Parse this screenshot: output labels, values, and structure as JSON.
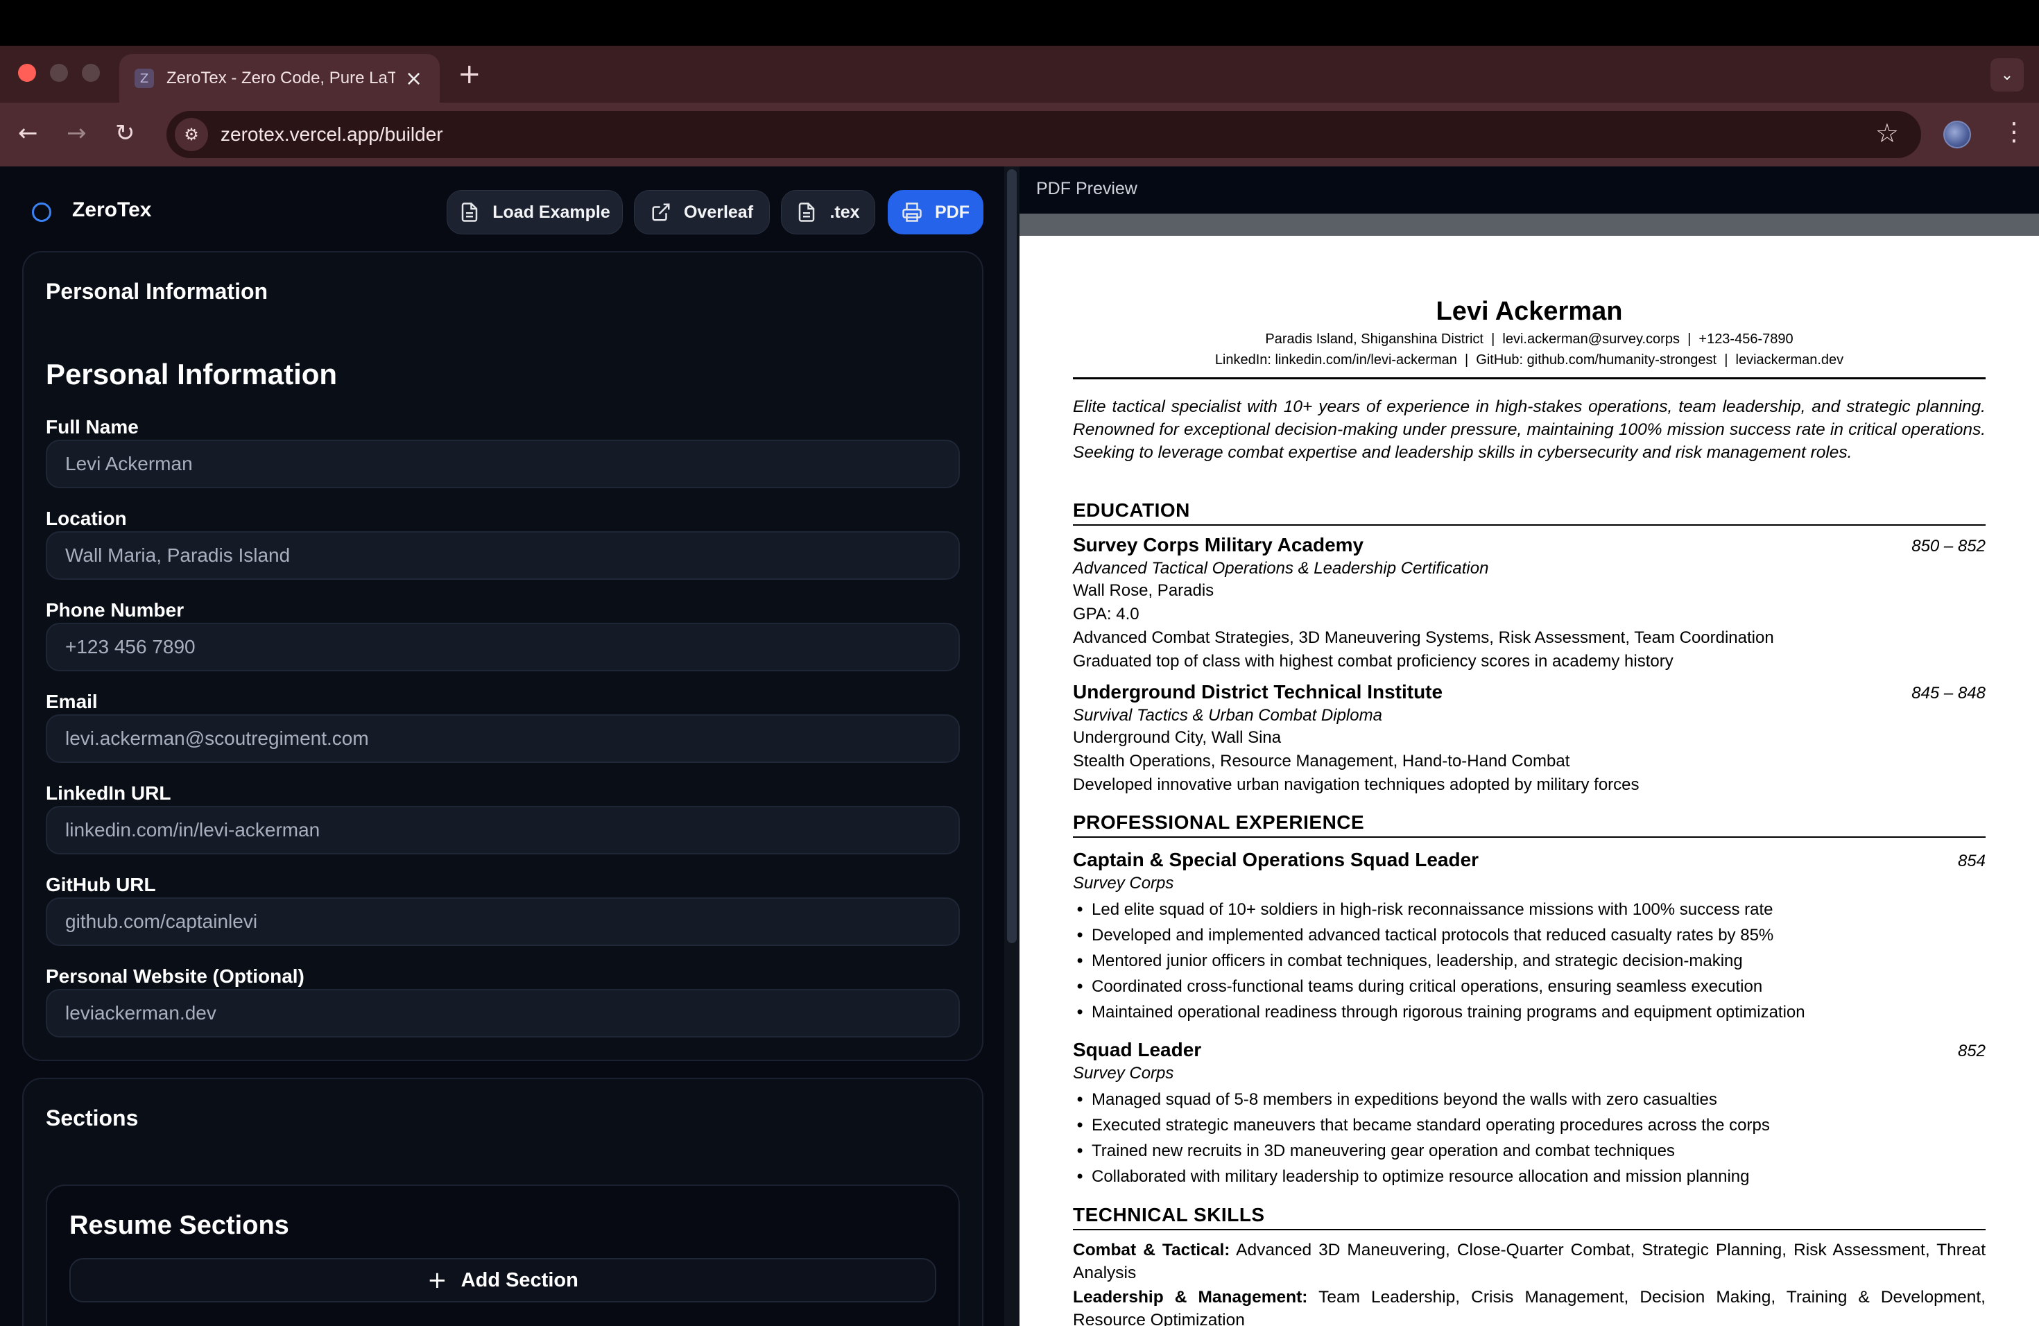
{
  "browser": {
    "tab_title": "ZeroTex - Zero Code, Pure LaTeX",
    "tab_favicon": "Z",
    "url": "zerotex.vercel.app/builder"
  },
  "app": {
    "logo": "ZeroTex",
    "toolbar": {
      "load_example": "Load Example",
      "overleaf": "Overleaf",
      "tex": ".tex",
      "pdf": "PDF"
    },
    "personal_card_title": "Personal Information",
    "personal_heading": "Personal Information",
    "fields": [
      {
        "label": "Full Name",
        "value": "Levi Ackerman"
      },
      {
        "label": "Location",
        "value": "Wall Maria, Paradis Island"
      },
      {
        "label": "Phone Number",
        "value": "+123 456 7890"
      },
      {
        "label": "Email",
        "value": "levi.ackerman@scoutregiment.com"
      },
      {
        "label": "LinkedIn URL",
        "value": "linkedin.com/in/levi-ackerman"
      },
      {
        "label": "GitHub URL",
        "value": "github.com/captainlevi"
      },
      {
        "label": "Personal Website (Optional)",
        "value": "leviackerman.dev"
      }
    ],
    "sections_card_title": "Sections",
    "resume_sections_title": "Resume Sections",
    "add_section": "Add Section"
  },
  "preview": {
    "header": "PDF Preview",
    "name": "Levi Ackerman",
    "contact_line1": "Paradis Island, Shiganshina District  |  levi.ackerman@survey.corps  |  +123-456-7890",
    "contact_line2": "LinkedIn: linkedin.com/in/levi-ackerman  |  GitHub: github.com/humanity-strongest  |  leviackerman.dev",
    "summary": "Elite tactical specialist with 10+ years of experience in high-stakes operations, team leadership, and strategic planning. Renowned for exceptional decision-making under pressure, maintaining 100% mission success rate in critical operations. Seeking to leverage combat expertise and leadership skills in cybersecurity and risk management roles.",
    "education_heading": "EDUCATION",
    "edu1": {
      "school": "Survey Corps Military Academy",
      "dates": "850 – 852",
      "program": "Advanced Tactical Operations & Leadership Certification",
      "location": "Wall Rose, Paradis",
      "gpa": "GPA: 4.0",
      "courses": "Advanced Combat Strategies, 3D Maneuvering Systems, Risk Assessment, Team Coordination",
      "note": "Graduated top of class with highest combat proficiency scores in academy history"
    },
    "edu2": {
      "school": "Underground District Technical Institute",
      "dates": "845 – 848",
      "program": "Survival Tactics & Urban Combat Diploma",
      "location": "Underground City, Wall Sina",
      "courses": "Stealth Operations, Resource Management, Hand-to-Hand Combat",
      "note": "Developed innovative urban navigation techniques adopted by military forces"
    },
    "experience_heading": "PROFESSIONAL EXPERIENCE",
    "exp1": {
      "title": "Captain & Special Operations Squad Leader",
      "date": "854",
      "org": "Survey Corps",
      "bullets": [
        "Led elite squad of 10+ soldiers in high-risk reconnaissance missions with 100% success rate",
        "Developed and implemented advanced tactical protocols that reduced casualty rates by 85%",
        "Mentored junior officers in combat techniques, leadership, and strategic decision-making",
        "Coordinated cross-functional teams during critical operations, ensuring seamless execution",
        "Maintained operational readiness through rigorous training programs and equipment optimization"
      ]
    },
    "exp2": {
      "title": "Squad Leader",
      "date": "852",
      "org": "Survey Corps",
      "bullets": [
        "Managed squad of 5-8 members in expeditions beyond the walls with zero casualties",
        "Executed strategic maneuvers that became standard operating procedures across the corps",
        "Trained new recruits in 3D maneuvering gear operation and combat techniques",
        "Collaborated with military leadership to optimize resource allocation and mission planning"
      ]
    },
    "skills_heading": "TECHNICAL SKILLS",
    "skill1_label": "Combat & Tactical:",
    "skill1_text": " Advanced 3D Maneuvering, Close-Quarter Combat, Strategic Planning, Risk Assessment, Threat Analysis",
    "skill2_label": "Leadership & Management:",
    "skill2_text": " Team Leadership, Crisis Management, Decision Making, Training & Development, Resource Optimization"
  }
}
